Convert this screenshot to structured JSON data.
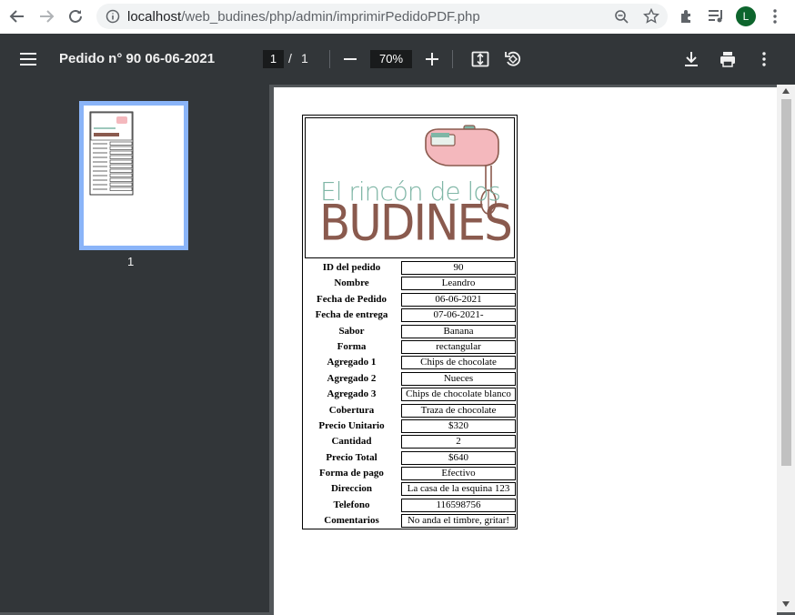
{
  "browser": {
    "url_host": "localhost",
    "url_path": "/web_budines/php/admin/imprimirPedidoPDF.php",
    "avatar_letter": "L"
  },
  "toolbar": {
    "title": "Pedido n° 90 06-06-2021",
    "current_page": "1",
    "page_separator": "/",
    "total_pages": "1",
    "zoom": "70%"
  },
  "sidebar": {
    "thumbnail_label": "1"
  },
  "document": {
    "logo": {
      "line1": "El rincón de los",
      "line2": "BUDINES"
    },
    "rows": [
      {
        "label": "ID del pedido",
        "value": "90"
      },
      {
        "label": "Nombre",
        "value": "Leandro"
      },
      {
        "label": "Fecha de Pedido",
        "value": "06-06-2021"
      },
      {
        "label": "Fecha de entrega",
        "value": "07-06-2021-"
      },
      {
        "label": "Sabor",
        "value": "Banana"
      },
      {
        "label": "Forma",
        "value": "rectangular"
      },
      {
        "label": "Agregado 1",
        "value": "Chips de chocolate"
      },
      {
        "label": "Agregado 2",
        "value": "Nueces"
      },
      {
        "label": "Agregado 3",
        "value": "Chips de chocolate blanco"
      },
      {
        "label": "Cobertura",
        "value": "Traza de chocolate"
      },
      {
        "label": "Precio Unitario",
        "value": "$320"
      },
      {
        "label": "Cantidad",
        "value": "2"
      },
      {
        "label": "Precio Total",
        "value": "$640"
      },
      {
        "label": "Forma de pago",
        "value": "Efectivo"
      },
      {
        "label": "Direccion",
        "value": "La casa de la esquina 123"
      },
      {
        "label": "Telefono",
        "value": "116598756"
      },
      {
        "label": "Comentarios",
        "value": "No anda el timbre, gritar!"
      }
    ]
  },
  "colors": {
    "toolbar_bg": "#323639",
    "viewer_bg": "#525659",
    "thumb_highlight": "#8ab4f8",
    "avatar_bg": "#0d652d",
    "logo_teal": "#7fb6a6",
    "logo_brown": "#8a5a4e",
    "mixer_pink": "#f4b8bd"
  }
}
